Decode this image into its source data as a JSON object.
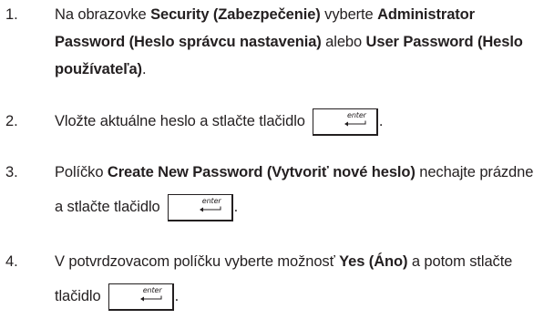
{
  "steps": [
    {
      "number": "1.",
      "t1": "Na obrazovke ",
      "b1": "Security (Zabezpečenie)",
      "t2": " vyberte ",
      "b2": "Administrator Password (Heslo správcu nastavenia)",
      "t3": " alebo ",
      "b3": "User Password (Heslo používateľa)",
      "t4": "."
    },
    {
      "number": "2.",
      "t1": "Vložte aktuálne heslo a stlačte tlačidlo",
      "t2": "."
    },
    {
      "number": "3.",
      "t1": "Políčko ",
      "b1": "Create New Password (Vytvoriť nové heslo)",
      "t2": " nechajte prázdne a stlačte tlačidlo",
      "t3": "."
    },
    {
      "number": "4.",
      "t1": "V potvrdzovacom políčku vyberte možnosť ",
      "b1": "Yes (Áno)",
      "t2": " a potom stlačte tlačidlo",
      "t3": "."
    }
  ],
  "enter_key": {
    "label": "enter",
    "icon": "enter-arrow-icon"
  }
}
